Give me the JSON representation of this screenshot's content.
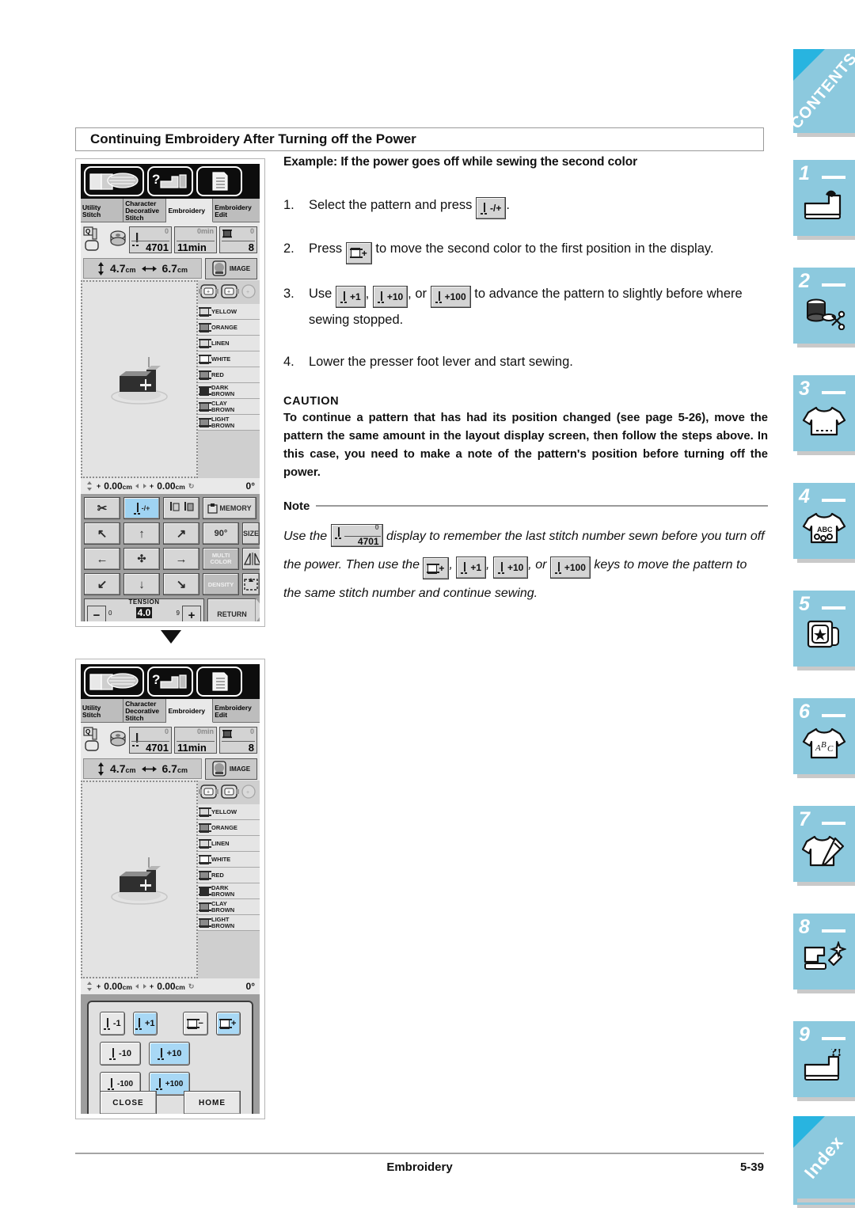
{
  "document": {
    "section_heading": "Continuing Embroidery After Turning off the Power",
    "footer_title": "Embroidery",
    "footer_page": "5-39"
  },
  "prose": {
    "example_title": "Example:  If the power goes off while sewing the second color",
    "steps": [
      {
        "n": "1.",
        "a": "Select the pattern and press",
        "key": "needle-minus-plus",
        "key_label": "-/+",
        "b": "."
      },
      {
        "n": "2.",
        "a": "Press",
        "key": "color-plus",
        "key_label": "+",
        "b": "to move the second color to the first position in the display."
      },
      {
        "n": "3.",
        "a": "Use",
        "key1_label": "+1",
        "key2_label": "+10",
        "key3_label": "+100",
        "sep1": ",",
        "sep2": ", or",
        "b": "to advance the pattern to slightly before where sewing stopped."
      },
      {
        "n": "4.",
        "a": "Lower the presser foot lever and start sewing.",
        "key": "",
        "key_label": "",
        "b": ""
      }
    ],
    "caution": {
      "heading": "CAUTION",
      "body": "To continue a pattern that has had its position changed (see page 5-26), move the pattern the same amount in the layout display screen, then follow the steps above. In this case, you need to make a note of the pattern's position before turning off the power."
    },
    "note": {
      "heading": "Note",
      "p1_a": "Use the",
      "p1_chip_zero": "0",
      "p1_chip_value": "4701",
      "p1_b": "display to remember the last stitch number sewn",
      "p2_a": "before you turn off the power. Then use the",
      "p2_k1": "+",
      "p2_k2": "+1",
      "p2_k3": "+10",
      "p2_sep1": ",",
      "p2_sep2": ",",
      "p2_sep3": ", or",
      "p3_k4": "+100",
      "p3_b": "keys to move the pattern to the same stitch number and continue sewing."
    }
  },
  "screenshot_top": {
    "tabs": [
      {
        "line1": "Utility",
        "line2": "Stitch",
        "selected": false
      },
      {
        "line1": "Character",
        "line2": "Decorative",
        "line3": "Stitch",
        "selected": false
      },
      {
        "line1": "Embroidery",
        "line2": "",
        "selected": true
      },
      {
        "line1": "Embroidery",
        "line2": "Edit",
        "selected": false
      }
    ],
    "info": {
      "stitch_top": "0",
      "stitch_count": "4701",
      "time_top": "0min",
      "time_value": "11min",
      "color_top": "0",
      "color_value": "8"
    },
    "size": {
      "height": "4.7",
      "height_unit": "cm",
      "width": "6.7",
      "width_unit": "cm",
      "image_label": "IMAGE"
    },
    "colors": [
      {
        "name": "YELLOW",
        "fill": "lt"
      },
      {
        "name": "ORANGE",
        "fill": "mid"
      },
      {
        "name": "LINEN",
        "fill": "lt"
      },
      {
        "name": "WHITE",
        "fill": "none"
      },
      {
        "name": "RED",
        "fill": "mid"
      },
      {
        "name": "DARK BROWN",
        "fill": "dark"
      },
      {
        "name": "CLAY BROWN",
        "fill": "mid"
      },
      {
        "name": "LIGHT BROWN",
        "fill": "mid"
      }
    ],
    "coords": {
      "v_value": "0.00",
      "v_unit": "cm",
      "h_value": "0.00",
      "h_unit": "cm",
      "angle": "0°"
    },
    "keys": {
      "row1": [
        {
          "label": "scissors-icon",
          "text": "✂",
          "state": "normal"
        },
        {
          "label": "needle-minus-plus",
          "text": "-/+",
          "state": "selected"
        },
        {
          "label": "thread-trim-pair",
          "text": "",
          "state": "normal"
        },
        {
          "label": "memory",
          "text": "MEMORY",
          "state": "normal"
        }
      ],
      "row2": [
        {
          "label": "move-up-left",
          "text": "↖",
          "state": "normal"
        },
        {
          "label": "move-up",
          "text": "↑",
          "state": "normal"
        },
        {
          "label": "move-up-right",
          "text": "↗",
          "state": "normal"
        },
        {
          "label": "rotate",
          "text": "90°",
          "state": "normal"
        },
        {
          "label": "size",
          "text": "SIZE",
          "state": "normal"
        }
      ],
      "row3": [
        {
          "label": "move-left",
          "text": "←",
          "state": "normal"
        },
        {
          "label": "center",
          "text": "✣",
          "state": "normal"
        },
        {
          "label": "move-right",
          "text": "→",
          "state": "normal"
        },
        {
          "label": "multi-color",
          "text": "MULTI COLOR",
          "state": "disabled"
        },
        {
          "label": "mirror",
          "text": "",
          "state": "normal"
        }
      ],
      "row4": [
        {
          "label": "move-down-left",
          "text": "↙",
          "state": "normal"
        },
        {
          "label": "move-down",
          "text": "↓",
          "state": "normal"
        },
        {
          "label": "move-down-right",
          "text": "↘",
          "state": "normal"
        },
        {
          "label": "density",
          "text": "DENSITY",
          "state": "disabled"
        },
        {
          "label": "trial",
          "text": "",
          "state": "normal"
        }
      ]
    },
    "tension": {
      "label": "TENSION",
      "value": "4.0",
      "min": "0",
      "max": "9",
      "minus": "−",
      "plus": "+"
    },
    "return_label": "RETURN"
  },
  "screenshot_bottom": {
    "tabs": [
      {
        "line1": "Utility",
        "line2": "Stitch",
        "selected": false
      },
      {
        "line1": "Character",
        "line2": "Decorative",
        "line3": "Stitch",
        "selected": false
      },
      {
        "line1": "Embroidery",
        "line2": "",
        "selected": true
      },
      {
        "line1": "Embroidery",
        "line2": "Edit",
        "selected": false
      }
    ],
    "info": {
      "stitch_top": "0",
      "stitch_count": "4701",
      "time_top": "0min",
      "time_value": "11min",
      "color_top": "0",
      "color_value": "8"
    },
    "size": {
      "height": "4.7",
      "height_unit": "cm",
      "width": "6.7",
      "width_unit": "cm",
      "image_label": "IMAGE"
    },
    "colors": [
      {
        "name": "YELLOW",
        "fill": "lt"
      },
      {
        "name": "ORANGE",
        "fill": "mid"
      },
      {
        "name": "LINEN",
        "fill": "lt"
      },
      {
        "name": "WHITE",
        "fill": "none"
      },
      {
        "name": "RED",
        "fill": "mid"
      },
      {
        "name": "DARK BROWN",
        "fill": "dark"
      },
      {
        "name": "CLAY BROWN",
        "fill": "mid"
      },
      {
        "name": "LIGHT BROWN",
        "fill": "mid"
      }
    ],
    "coords": {
      "v_value": "0.00",
      "v_unit": "cm",
      "h_value": "0.00",
      "h_unit": "cm",
      "angle": "0°"
    },
    "popup": {
      "keys": [
        {
          "label": "stitch-minus-1",
          "text": "-1",
          "selected": false
        },
        {
          "label": "stitch-plus-1",
          "text": "+1",
          "selected": true
        },
        {
          "label": "color-minus",
          "text": "−",
          "selected": false
        },
        {
          "label": "color-plus",
          "text": "+",
          "selected": true
        },
        {
          "label": "stitch-minus-10",
          "text": "-10",
          "selected": false
        },
        {
          "label": "stitch-plus-10",
          "text": "+10",
          "selected": true
        },
        {
          "label": "stitch-minus-100",
          "text": "-100",
          "selected": false
        },
        {
          "label": "stitch-plus-100",
          "text": "+100",
          "selected": true
        }
      ],
      "close_label": "CLOSE",
      "home_label": "HOME"
    }
  },
  "rail": {
    "contents_label": "CONTENTS",
    "index_label": "Index",
    "accent": "#8cc9de",
    "corner_accent": "#28b4e0",
    "tabs": [
      {
        "num": "1",
        "icon": "sewing-machine-icon"
      },
      {
        "num": "2",
        "icon": "spool-scissors-icon"
      },
      {
        "num": "3",
        "icon": "tshirt-icon"
      },
      {
        "num": "4",
        "icon": "tshirt-abc-icon"
      },
      {
        "num": "5",
        "icon": "embroidery-card-icon"
      },
      {
        "num": "6",
        "icon": "tshirt-letters-icon"
      },
      {
        "num": "7",
        "icon": "tshirt-edit-icon"
      },
      {
        "num": "8",
        "icon": "maintenance-icon"
      },
      {
        "num": "9",
        "icon": "troubleshoot-icon"
      },
      {
        "num": "",
        "icon": "pages-icon"
      }
    ]
  }
}
